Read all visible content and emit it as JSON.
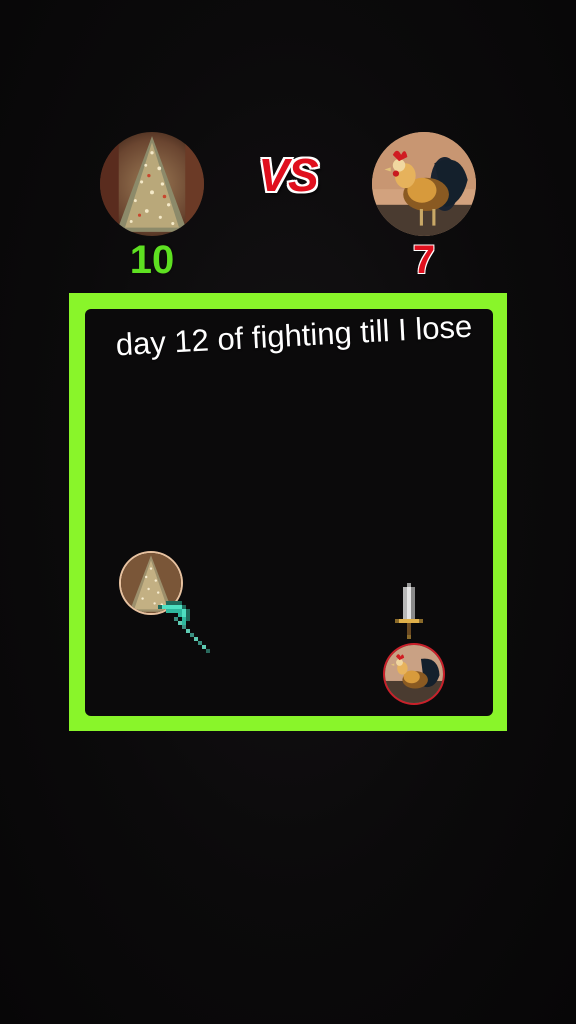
{
  "player1": {
    "score": "10",
    "score_color": "#5ee021",
    "avatar_icon": "christmas-tree-photo",
    "weapon_icon": "diamond-pickaxe-icon"
  },
  "player2": {
    "score": "7",
    "score_color": "#e0101e",
    "avatar_icon": "rooster-photo",
    "weapon_icon": "iron-sword-icon"
  },
  "vs_label": "VS",
  "caption": "day 12 of fighting till I lose",
  "colors": {
    "arena_border": "#89f52a",
    "background": "#0b0a0b",
    "vs": "#e0101e"
  }
}
